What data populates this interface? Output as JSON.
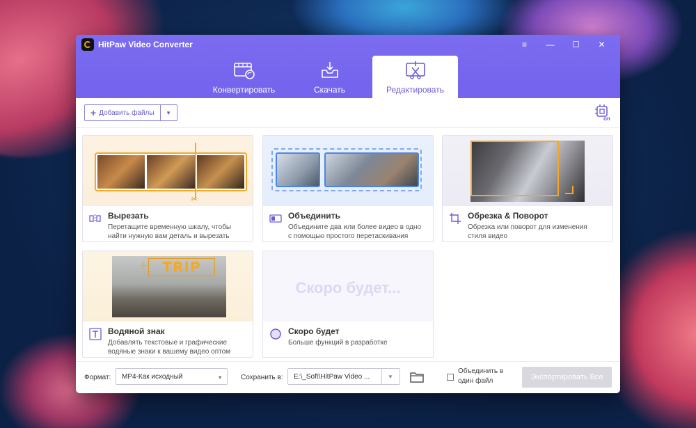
{
  "window": {
    "title": "HitPaw Video Converter",
    "controls": [
      "≡",
      "—",
      "☐",
      "✕"
    ]
  },
  "tabs": [
    {
      "label": "Конвертировать",
      "icon": "film-convert-icon"
    },
    {
      "label": "Скачать",
      "icon": "download-tray-icon"
    },
    {
      "label": "Редактировать",
      "icon": "edit-scissors-icon",
      "active": true
    }
  ],
  "toolbar": {
    "add_files_label": "Добавить файлы",
    "hw_accel_icon": "hardware-acceleration-on-icon",
    "hw_badge": "on"
  },
  "cards": [
    {
      "title": "Вырезать",
      "desc_line1": "Перетащите временную шкалу, чтобы",
      "desc_line2": "найти нужную вам деталь и вырезать",
      "icon": "cut-segments-icon"
    },
    {
      "title": "Объединить",
      "desc_line1": "Объедините два или более видео в одно",
      "desc_line2": "с помощью простого перетаскивания",
      "icon": "merge-icon"
    },
    {
      "title": "Обрезка & Поворот",
      "desc_line1": "Обрезка или поворот для изменения",
      "desc_line2": "стиля видео",
      "icon": "crop-icon"
    },
    {
      "title": "Водяной знак",
      "desc_line1": "Добавлять текстовые и графические",
      "desc_line2": "водяные знаки к вашему видео оптом",
      "icon": "watermark-text-icon",
      "overlay_text": "TRIP"
    },
    {
      "title": "Скоро будет",
      "desc_line1": "Больше функций в разработке",
      "desc_line2": "",
      "icon": "coming-soon-circle-icon",
      "placeholder_text": "Скоро будет..."
    }
  ],
  "bottom": {
    "format_label": "Формат:",
    "format_value": "MP4-Как исходный",
    "save_label": "Сохранить в:",
    "save_path": "E:\\_Soft\\HitPaw Video ...",
    "merge_line1": "Объединить в",
    "merge_line2": "один файл",
    "export_label": "Экспортировать Все"
  },
  "colors": {
    "accent": "#7363ee",
    "orange": "#f4a823",
    "blue_frame": "#4a86e8"
  }
}
